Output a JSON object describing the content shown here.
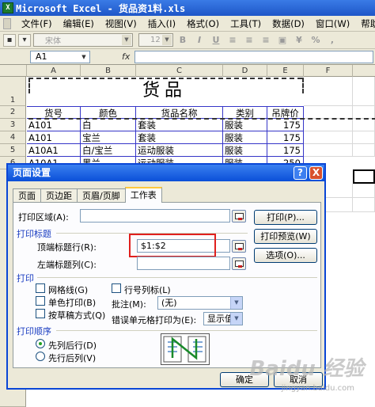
{
  "window": {
    "title": "Microsoft Excel - 货品资1料.xls",
    "icon": "excel-icon"
  },
  "menu": [
    "文件(F)",
    "编辑(E)",
    "视图(V)",
    "插入(I)",
    "格式(O)",
    "工具(T)",
    "数据(D)",
    "窗口(W)",
    "帮助(H)"
  ],
  "toolbar": {
    "font_name": "宋体",
    "font_size": "12",
    "bold": "B",
    "italic": "I",
    "underline": "U",
    "percent": "%",
    "comma": ","
  },
  "namebox": "A1",
  "fx_label": "fx",
  "columns": [
    "A",
    "B",
    "C",
    "D",
    "E",
    "F"
  ],
  "rows": [
    "1",
    "2",
    "3",
    "4",
    "5",
    "6"
  ],
  "sheet": {
    "title": "货品",
    "headers": [
      "货号",
      "颜色",
      "货品名称",
      "类别",
      "吊牌价"
    ],
    "data": [
      [
        "A101",
        "白",
        "套装",
        "服装",
        "175"
      ],
      [
        "A101",
        "宝兰",
        "套装",
        "服装",
        "175"
      ],
      [
        "A10A1",
        "白/宝兰",
        "运动服装",
        "服装",
        "175"
      ],
      [
        "A10A1",
        "黑兰",
        "运动服装",
        "服装",
        "250"
      ]
    ]
  },
  "dialog": {
    "title": "页面设置",
    "help": "?",
    "close": "X",
    "tabs": [
      "页面",
      "页边距",
      "页眉/页脚",
      "工作表"
    ],
    "print_area_label": "打印区域(A):",
    "print_titles_group": "打印标题",
    "top_rows_label": "顶端标题行(R):",
    "top_rows_value": "$1:$2",
    "left_cols_label": "左端标题列(C):",
    "print_group": "打印",
    "gridlines": "网格线(G)",
    "mono": "单色打印(B)",
    "draft": "按草稿方式(Q)",
    "row_col_headers": "行号列标(L)",
    "comments_label": "批注(M):",
    "comments_value": "(无)",
    "errors_label": "错误单元格打印为(E):",
    "errors_value": "显示值",
    "order_group": "打印顺序",
    "down_then_over": "先列后行(D)",
    "over_then_down": "先行后列(V)",
    "btn_print": "打印(P)...",
    "btn_preview": "打印预览(W)",
    "btn_options": "选项(O)...",
    "btn_ok": "确定",
    "btn_cancel": "取消"
  },
  "watermark": {
    "text": "Baidu 经验",
    "sub": "jingyan.baidu.com"
  }
}
